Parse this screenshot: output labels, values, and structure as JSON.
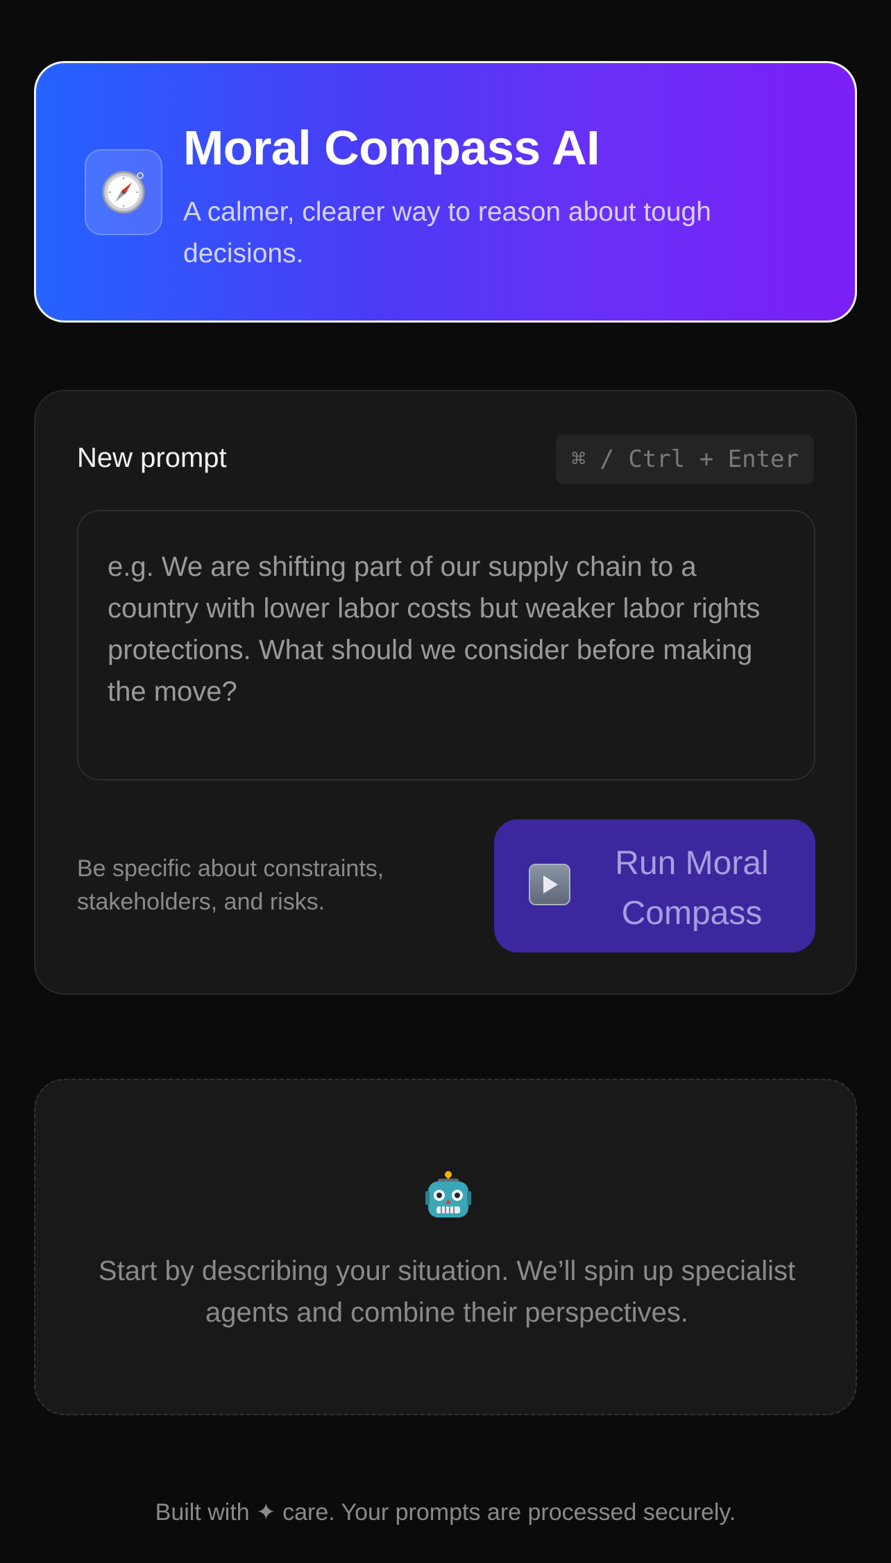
{
  "header": {
    "title": "Moral Compass AI",
    "subtitle": "A calmer, clearer way to reason about tough decisions.",
    "icon": "compass-icon",
    "gradient": [
      "#2463ff",
      "#7b1ff7"
    ]
  },
  "prompt": {
    "label": "New prompt",
    "shortcut": "⌘ / Ctrl + Enter",
    "placeholder": "e.g. We are shifting part of our supply chain to a country with lower labor costs but weaker labor rights protections. What should we consider before making the move?",
    "value": "",
    "helper": "Be specific about constraints, stakeholders, and risks.",
    "run_label": "Run Moral Compass",
    "run_icon": "play-icon",
    "accent": "#3c279e"
  },
  "empty_state": {
    "icon": "robot-icon",
    "message": "Start by describing your situation. We’ll spin up specialist agents and combine their perspectives."
  },
  "footer": {
    "text": "Built with ✦ care. Your prompts are processed securely."
  }
}
